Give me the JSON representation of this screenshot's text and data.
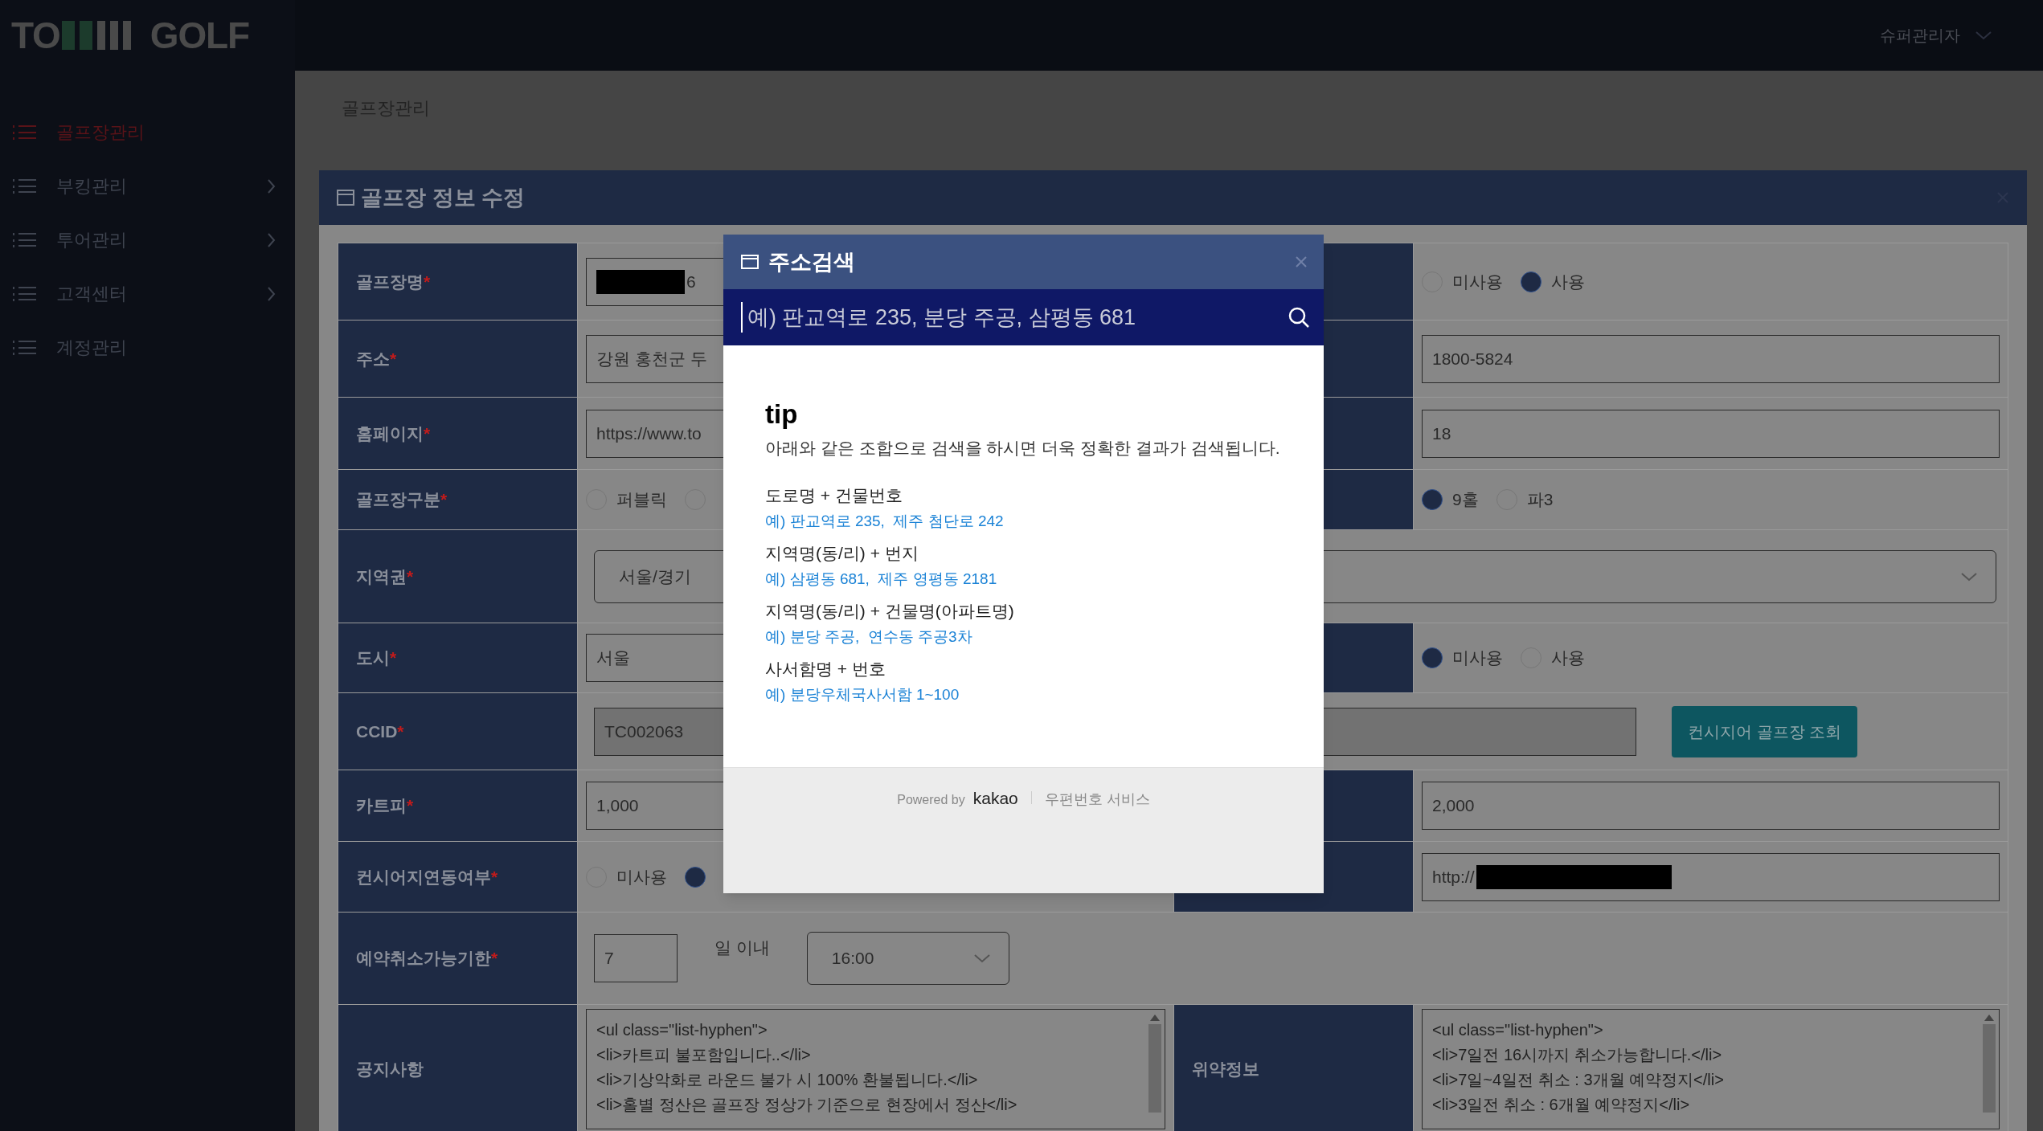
{
  "header": {
    "logo_left": "TO",
    "logo_right": "GOLF",
    "user": "슈퍼관리자"
  },
  "sidebar": {
    "items": [
      {
        "label": "골프장관리",
        "selected": true,
        "expandable": false
      },
      {
        "label": "부킹관리",
        "selected": false,
        "expandable": true
      },
      {
        "label": "투어관리",
        "selected": false,
        "expandable": true
      },
      {
        "label": "고객센터",
        "selected": false,
        "expandable": true
      },
      {
        "label": "계정관리",
        "selected": false,
        "expandable": false
      }
    ]
  },
  "breadcrumb": "골프장관리",
  "card": {
    "title": "골프장 정보 수정"
  },
  "form": {
    "required_mark": "*",
    "rows": [
      {
        "kind": "pair",
        "label": "골프장명",
        "required": true,
        "controls": [
          {
            "kind": "text",
            "value": "6",
            "redacted": true
          }
        ],
        "right": {
          "controls": [
            {
              "kind": "radios",
              "options": [
                {
                  "label": "미사용",
                  "selected": false
                },
                {
                  "label": "사용",
                  "selected": true
                }
              ]
            }
          ]
        }
      },
      {
        "kind": "pair",
        "label": "주소",
        "required": true,
        "controls": [
          {
            "kind": "text",
            "value": "강원 홍천군 두"
          }
        ],
        "right": {
          "controls": [
            {
              "kind": "text",
              "value": "1800-5824"
            }
          ]
        }
      },
      {
        "kind": "pair",
        "label": "홈페이지",
        "required": true,
        "controls": [
          {
            "kind": "text",
            "value": "https://www.to"
          }
        ],
        "right": {
          "controls": [
            {
              "kind": "text",
              "value": "18"
            }
          ]
        }
      },
      {
        "kind": "pair",
        "label": "골프장구분",
        "required": true,
        "controls": [
          {
            "kind": "radios",
            "options": [
              {
                "label": "퍼블릭",
                "selected": false
              },
              {
                "selected": false
              }
            ]
          }
        ],
        "right": {
          "controls": [
            {
              "kind": "radios",
              "options": [
                {
                  "label": "9홀",
                  "selected": true
                },
                {
                  "label": "파3",
                  "selected": false
                }
              ]
            }
          ]
        }
      },
      {
        "kind": "region",
        "label": "지역권",
        "required": true,
        "controls": [
          {
            "kind": "select",
            "value": "서울/경기"
          },
          {
            "kind": "select"
          }
        ]
      },
      {
        "kind": "pair",
        "label": "도시",
        "required": true,
        "controls": [
          {
            "kind": "text",
            "value": "서울"
          }
        ],
        "right": {
          "controls": [
            {
              "kind": "radios",
              "options": [
                {
                  "label": "미사용",
                  "selected": true
                },
                {
                  "label": "사용",
                  "selected": false
                }
              ]
            }
          ]
        }
      },
      {
        "kind": "ccid",
        "label": "CCID",
        "required": true,
        "controls": [
          {
            "kind": "text",
            "value": "TC002063",
            "disabled": true
          },
          {
            "kind": "button",
            "label": "컨시지어 골프장 조회"
          }
        ]
      },
      {
        "kind": "pair",
        "label": "카트피",
        "required": true,
        "controls": [
          {
            "kind": "text",
            "value": "1,000"
          }
        ],
        "right": {
          "controls": [
            {
              "kind": "text",
              "value": "2,000"
            }
          ]
        }
      },
      {
        "kind": "pair",
        "label": "컨시어지연동여부",
        "required": true,
        "controls": [
          {
            "kind": "radios",
            "options": [
              {
                "label": "미사용",
                "selected": false
              },
              {
                "selected": true
              }
            ]
          }
        ],
        "right": {
          "controls": [
            {
              "kind": "text",
              "value": "http://",
              "redacted": true
            }
          ]
        }
      },
      {
        "kind": "cancel",
        "label": "예약취소가능기한",
        "required": true,
        "controls": [
          {
            "kind": "text",
            "value": "7"
          },
          {
            "kind": "note",
            "text": "일 이내"
          },
          {
            "kind": "select",
            "value": "16:00"
          }
        ]
      },
      {
        "kind": "pair",
        "label": "공지사항",
        "required": false,
        "controls": [
          {
            "kind": "textarea",
            "lines": [
              "<ul class=\"list-hyphen\">",
              "<li>카트피 불포함입니다..</li>",
              "<li>기상악화로 라운드 불가 시 100% 환불됩니다.</li>",
              "<li>홀별 정산은 골프장 정상가 기준으로 현장에서 정산</li>"
            ]
          }
        ],
        "right": {
          "label": "위약정보",
          "controls": [
            {
              "kind": "textarea",
              "lines": [
                "<ul class=\"list-hyphen\">",
                "<li>7일전 16시까지 취소가능합니다.</li>",
                "<li>7일~4일전 취소 : 3개월 예약정지</li>",
                "<li>3일전 취소 : 6개월 예약정지</li>"
              ]
            }
          ]
        }
      }
    ]
  },
  "modal": {
    "title": "주소검색",
    "search_placeholder": "예) 판교역로 235, 분당 주공, 삼평동 681",
    "tip_title": "tip",
    "tip_text": "아래와 같은 조합으로 검색을 하시면 더욱 정확한 결과가 검색됩니다.",
    "groups": [
      {
        "heading": "도로명 + 건물번호",
        "example": "예) 판교역로 235,  제주 첨단로 242"
      },
      {
        "heading": "지역명(동/리) + 번지",
        "example": "예) 삼평동 681,  제주 영평동 2181"
      },
      {
        "heading": "지역명(동/리) + 건물명(아파트명)",
        "example": "예) 분당 주공,  연수동 주공3차"
      },
      {
        "heading": "사서함명 + 번호",
        "example": "예) 분당우체국사서함 1~100"
      }
    ],
    "powered": "Powered by",
    "brand": "kakao",
    "service": "우편번호 서비스"
  }
}
